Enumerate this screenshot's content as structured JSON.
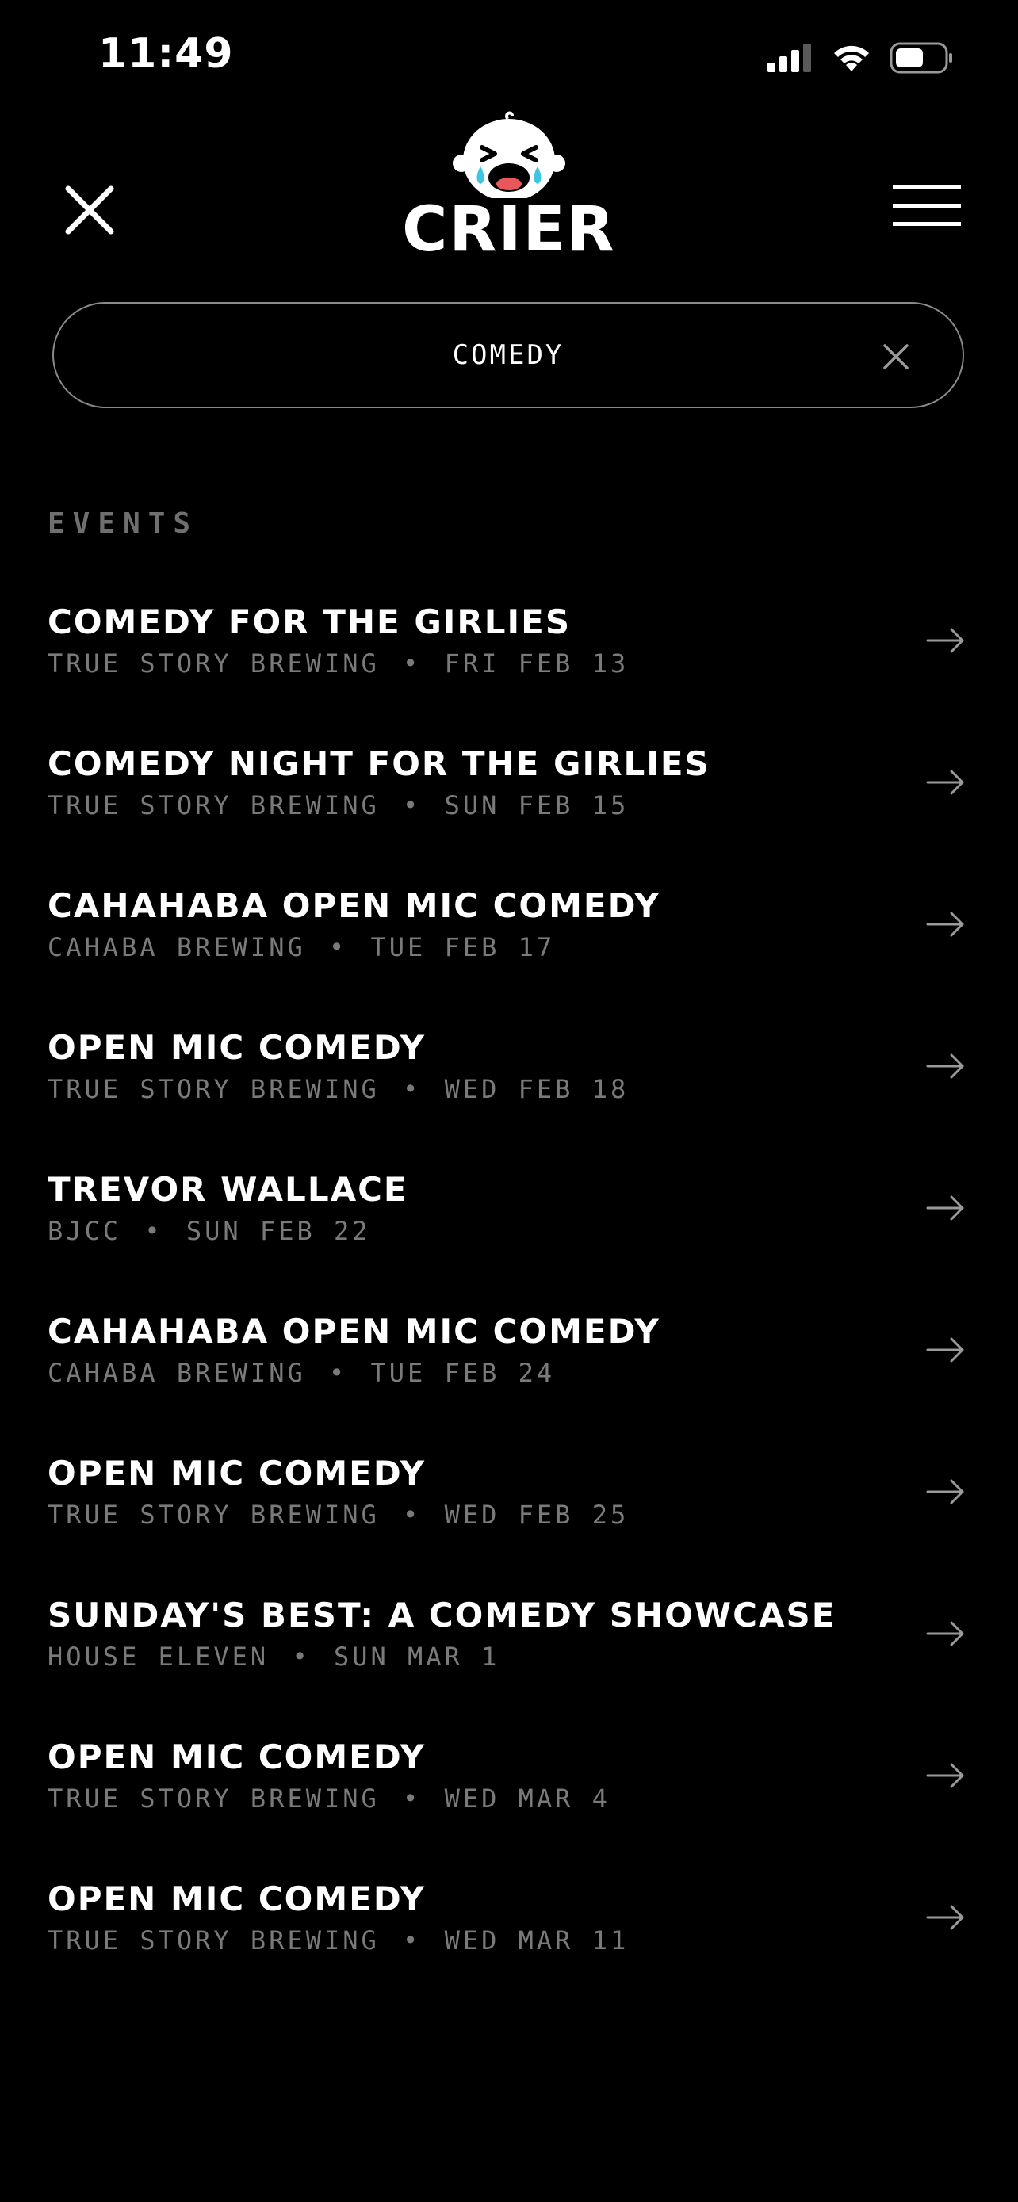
{
  "status_bar": {
    "time": "11:49",
    "icons": [
      "signal-icon",
      "wifi-icon",
      "battery-icon"
    ]
  },
  "header": {
    "logo_text": "CRIER",
    "close_icon": "close-icon",
    "menu_icon": "hamburger-menu-icon"
  },
  "search": {
    "value": "COMEDY",
    "clear_icon": "clear-icon"
  },
  "events_section": {
    "label": "EVENTS",
    "items": [
      {
        "title": "COMEDY FOR THE GIRLIES",
        "venue": "TRUE STORY BREWING",
        "date": "FRI FEB 13"
      },
      {
        "title": "COMEDY NIGHT FOR THE GIRLIES",
        "venue": "TRUE STORY BREWING",
        "date": "SUN FEB 15"
      },
      {
        "title": "CAHAHABA OPEN MIC COMEDY",
        "venue": "CAHABA BREWING",
        "date": "TUE FEB 17"
      },
      {
        "title": "OPEN MIC COMEDY",
        "venue": "TRUE STORY BREWING",
        "date": "WED FEB 18"
      },
      {
        "title": "TREVOR WALLACE",
        "venue": "BJCC",
        "date": "SUN FEB 22"
      },
      {
        "title": "CAHAHABA OPEN MIC COMEDY",
        "venue": "CAHABA BREWING",
        "date": "TUE FEB 24"
      },
      {
        "title": "OPEN MIC COMEDY",
        "venue": "TRUE STORY BREWING",
        "date": "WED FEB 25"
      },
      {
        "title": "SUNDAY'S BEST: A COMEDY SHOWCASE",
        "venue": "HOUSE ELEVEN",
        "date": "SUN MAR 1"
      },
      {
        "title": "OPEN MIC COMEDY",
        "venue": "TRUE STORY BREWING",
        "date": "WED MAR 4"
      },
      {
        "title": "OPEN MIC COMEDY",
        "venue": "TRUE STORY BREWING",
        "date": "WED MAR 11"
      }
    ],
    "separator": "•",
    "arrow_icon": "arrow-right-icon"
  },
  "colors": {
    "background": "#000000",
    "text": "#ffffff",
    "muted": "#7a7a7a",
    "logo_mouth": "#e8575a",
    "logo_tears": "#3ec6e0"
  }
}
